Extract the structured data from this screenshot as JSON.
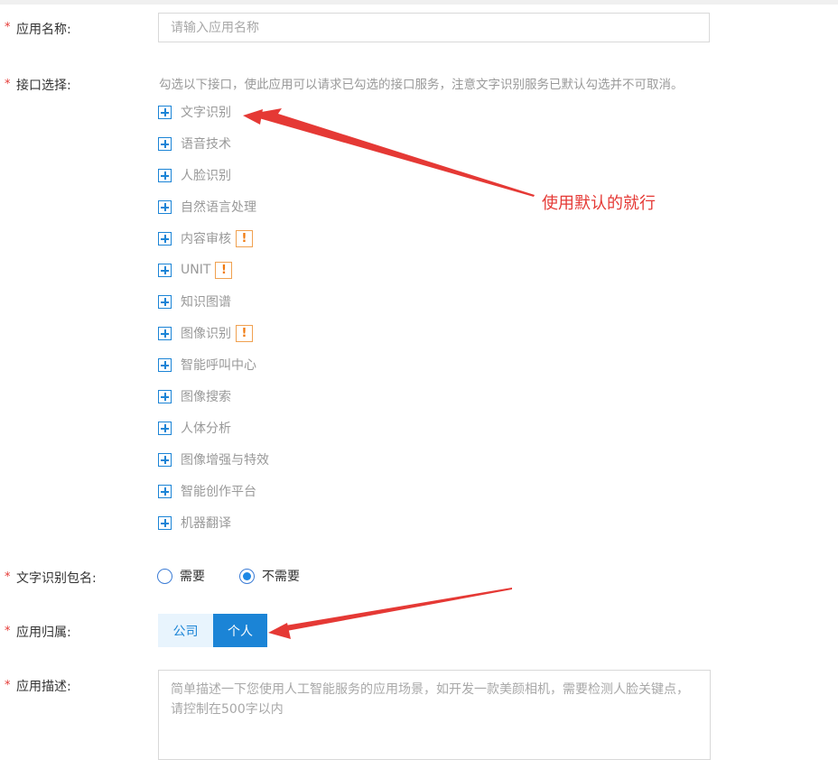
{
  "form": {
    "app_name": {
      "label": "应用名称:",
      "required_mark": "*",
      "placeholder": "请输入应用名称",
      "value": ""
    },
    "api_select": {
      "label": "接口选择:",
      "required_mark": "*",
      "hint": "勾选以下接口，使此应用可以请求已勾选的接口服务，注意文字识别服务已默认勾选并不可取消。",
      "items": [
        {
          "label": "文字识别",
          "warn": false
        },
        {
          "label": "语音技术",
          "warn": false
        },
        {
          "label": "人脸识别",
          "warn": false
        },
        {
          "label": "自然语言处理",
          "warn": false
        },
        {
          "label": "内容审核",
          "warn": true
        },
        {
          "label": "UNIT",
          "warn": true
        },
        {
          "label": "知识图谱",
          "warn": false
        },
        {
          "label": "图像识别",
          "warn": true
        },
        {
          "label": "智能呼叫中心",
          "warn": false
        },
        {
          "label": "图像搜索",
          "warn": false
        },
        {
          "label": "人体分析",
          "warn": false
        },
        {
          "label": "图像增强与特效",
          "warn": false
        },
        {
          "label": "智能创作平台",
          "warn": false
        },
        {
          "label": "机器翻译",
          "warn": false
        }
      ],
      "warn_symbol": "!"
    },
    "package_name": {
      "label": "文字识别包名:",
      "required_mark": "*",
      "options": [
        {
          "label": "需要",
          "checked": false
        },
        {
          "label": "不需要",
          "checked": true
        }
      ]
    },
    "ownership": {
      "label": "应用归属:",
      "required_mark": "*",
      "options": [
        {
          "label": "公司",
          "selected": false
        },
        {
          "label": "个人",
          "selected": true
        }
      ]
    },
    "description": {
      "label": "应用描述:",
      "required_mark": "*",
      "placeholder": "简单描述一下您使用人工智能服务的应用场景，如开发一款美颜相机，需要检测人脸关键点，请控制在500字以内",
      "value": ""
    }
  },
  "annotation": {
    "text": "使用默认的就行",
    "color": "#e53935"
  },
  "colors": {
    "accent": "#1b84d6",
    "warn": "#f07a10",
    "required": "#e53935",
    "annotation": "#e53935"
  }
}
